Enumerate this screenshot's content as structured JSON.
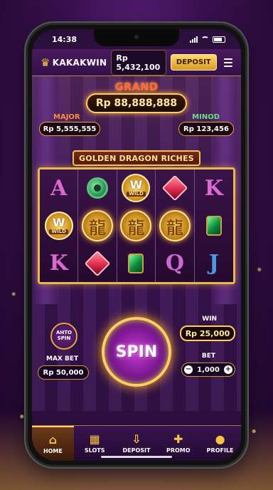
{
  "status_bar": {
    "time": "14:38"
  },
  "header": {
    "brand": "KAKAKWIN",
    "balance": "Rp 5,432,100",
    "deposit_label": "DEPOSIT"
  },
  "jackpots": {
    "grand_label": "GRAND",
    "grand_value": "Rp 88,888,888",
    "major_label": "MAJOR",
    "major_value": "Rp 5,555,555",
    "minor_label": "MINOD",
    "minor_value": "Rp 123,456"
  },
  "game": {
    "title": "GOLDEN DRAGON RICHES",
    "reels": [
      [
        {
          "type": "letter",
          "value": "A",
          "color": "#d86ad0"
        },
        {
          "type": "wild",
          "value": "W",
          "sub": "WILD"
        },
        {
          "type": "letter",
          "value": "K",
          "color": "#d86ad0"
        }
      ],
      [
        {
          "type": "jade"
        },
        {
          "type": "dragon"
        },
        {
          "type": "ruby",
          "color": "#e02a4a"
        }
      ],
      [
        {
          "type": "wild",
          "value": "W",
          "sub": "WILD"
        },
        {
          "type": "dragon"
        },
        {
          "type": "emerald"
        }
      ],
      [
        {
          "type": "ruby",
          "color": "#e02a4a"
        },
        {
          "type": "dragon"
        },
        {
          "type": "letter",
          "value": "Q",
          "color": "#c86ad0"
        }
      ],
      [
        {
          "type": "letter",
          "value": "K",
          "color": "#d86ad0"
        },
        {
          "type": "emerald"
        },
        {
          "type": "letter",
          "value": "J",
          "color": "#4a9ae0"
        }
      ]
    ]
  },
  "controls": {
    "auto_spin_label": "AHTO SPIN",
    "spin_label": "SPIN",
    "win_label": "WIN",
    "win_value": "Rp 25,000",
    "max_bet_label": "MAX BET",
    "max_bet_value": "Rp 50,000",
    "bet_label": "BET",
    "bet_value": "1,000",
    "bet_minus": "−",
    "bet_plus": "+"
  },
  "tabs": [
    {
      "label": "HOME",
      "icon": "home-icon",
      "active": true
    },
    {
      "label": "SLOTS",
      "icon": "slots-icon",
      "active": false
    },
    {
      "label": "DEPOSIT",
      "icon": "deposit-icon",
      "active": false
    },
    {
      "label": "PROMO",
      "icon": "gift-icon",
      "active": false
    },
    {
      "label": "PROFILE",
      "icon": "profile-icon",
      "active": false
    }
  ],
  "colors": {
    "accent_gold": "#ffcf5a",
    "bg_purple": "#3b1652",
    "major_label": "#ff8a3a",
    "minor_label": "#6adf8a"
  }
}
